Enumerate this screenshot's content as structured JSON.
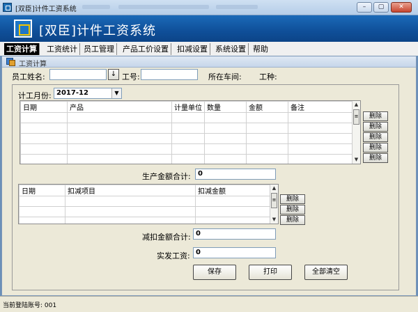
{
  "window": {
    "title": "[双臣]计件工资系统",
    "banner_title": "[双臣]计件工资系统",
    "min_label": "–",
    "max_label": "▢",
    "close_label": "✕"
  },
  "menu": {
    "items": [
      {
        "label": "工资计算",
        "active": true
      },
      {
        "label": "工资统计",
        "active": false
      },
      {
        "label": "员工管理",
        "active": false
      },
      {
        "label": "产品工价设置",
        "active": false
      },
      {
        "label": "扣减设置",
        "active": false
      },
      {
        "label": "系统设置",
        "active": false
      },
      {
        "label": "帮助",
        "active": false
      }
    ]
  },
  "child": {
    "title": "工资计算"
  },
  "form": {
    "employee_name_label": "员工姓名:",
    "employee_name_value": "",
    "lookup_button": "↓",
    "employee_no_label": "工号:",
    "employee_no_value": "",
    "workshop_label": "所在车间:",
    "job_label": "工种:",
    "month_label": "计工月份:",
    "month_value": "2017-12"
  },
  "production_table": {
    "headers": [
      "日期",
      "产品",
      "计量单位",
      "数量",
      "金额",
      "备注"
    ],
    "rows": 5,
    "delete_label": "删除"
  },
  "production_total": {
    "label": "生产金额合计:",
    "value": "0"
  },
  "deduction_table": {
    "headers": [
      "日期",
      "扣减项目",
      "扣减金额"
    ],
    "rows": 3,
    "delete_label": "删除"
  },
  "deduction_total": {
    "label": "减扣金额合计:",
    "value": "0"
  },
  "net_pay": {
    "label": "实发工资:",
    "value": "0"
  },
  "buttons": {
    "save": "保存",
    "print": "打印",
    "clear_all": "全部清空"
  },
  "status": {
    "text": "当前登陆账号: 001"
  }
}
